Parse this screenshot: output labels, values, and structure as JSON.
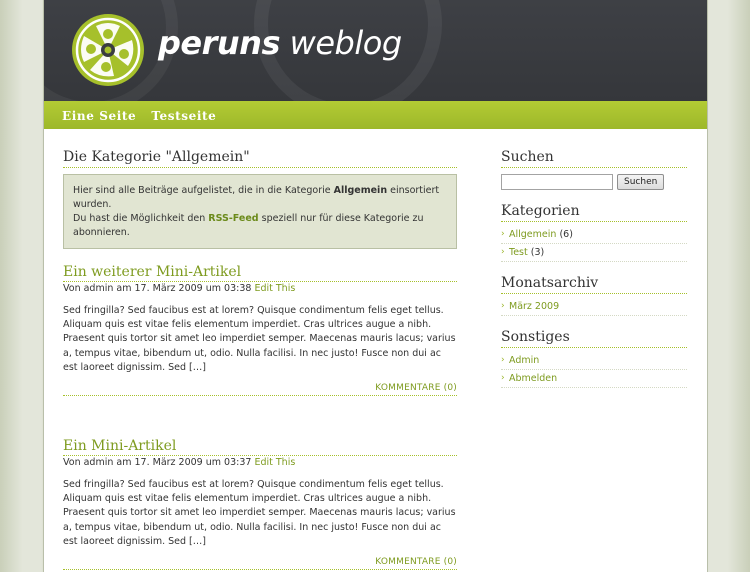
{
  "site": {
    "title_bold": "peruns",
    "title_rest": " weblog"
  },
  "nav": [
    {
      "label": "Eine Seite"
    },
    {
      "label": "Testseite"
    }
  ],
  "category": {
    "title": "Die Kategorie \"Allgemein\"",
    "notice_line1_pre": "Hier sind alle Beiträge aufgelistet, die in die Kategorie ",
    "notice_line1_bold": "Allgemein",
    "notice_line1_post": " einsortiert wurden.",
    "notice_line2_pre": "Du hast die Möglichkeit den ",
    "notice_link": "RSS-Feed",
    "notice_line2_post": " speziell nur für diese Kategorie zu abonnieren."
  },
  "posts": [
    {
      "title": "Ein weiterer Mini-Artikel",
      "meta": "Von admin am 17. März 2009 um 03:38 ",
      "edit": "Edit This",
      "excerpt": "Sed fringilla? Sed faucibus est at lorem? Quisque condimentum felis eget tellus. Aliquam quis est vitae felis elementum imperdiet. Cras ultrices augue a nibh. Praesent quis tortor sit amet leo imperdiet semper. Maecenas mauris lacus; varius a, tempus vitae, bibendum ut, odio. Nulla facilisi. In nec justo! Fusce non dui ac est laoreet dignissim. Sed […]",
      "comments": "KOMMENTARE (0)"
    },
    {
      "title": "Ein Mini-Artikel",
      "meta": "Von admin am 17. März 2009 um 03:37 ",
      "edit": "Edit This",
      "excerpt": "Sed fringilla? Sed faucibus est at lorem? Quisque condimentum felis eget tellus. Aliquam quis est vitae felis elementum imperdiet. Cras ultrices augue a nibh. Praesent quis tortor sit amet leo imperdiet semper. Maecenas mauris lacus; varius a, tempus vitae, bibendum ut, odio. Nulla facilisi. In nec justo! Fusce non dui ac est laoreet dignissim. Sed […]",
      "comments": "KOMMENTARE (0)"
    }
  ],
  "sidebar": {
    "search": {
      "heading": "Suchen",
      "button": "Suchen",
      "value": ""
    },
    "categories": {
      "heading": "Kategorien",
      "items": [
        {
          "label": "Allgemein",
          "count": " (6)"
        },
        {
          "label": "Test",
          "count": " (3)"
        }
      ]
    },
    "archive": {
      "heading": "Monatsarchiv",
      "items": [
        {
          "label": "März 2009"
        }
      ]
    },
    "misc": {
      "heading": "Sonstiges",
      "items": [
        {
          "label": "Admin"
        },
        {
          "label": "Abmelden"
        }
      ]
    }
  },
  "colors": {
    "accent": "#a6c02b",
    "header": "#3a3c40",
    "link": "#7e9b1f"
  }
}
